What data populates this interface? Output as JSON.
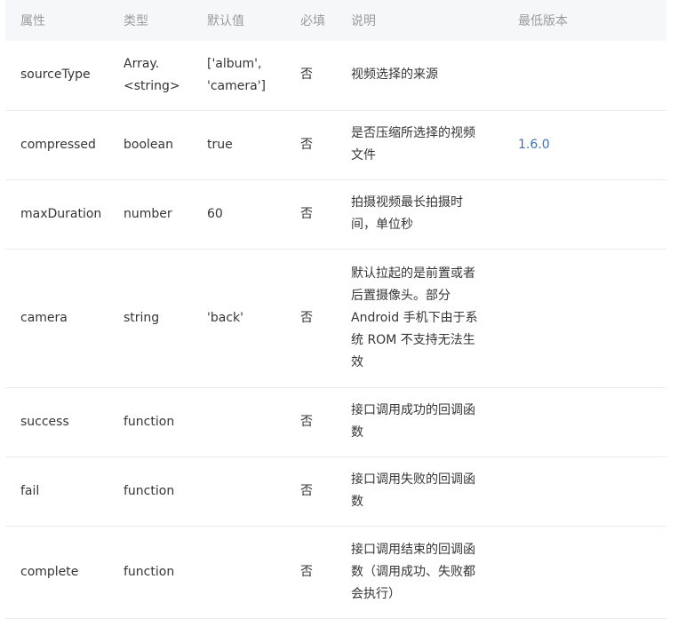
{
  "table": {
    "headers": [
      "属性",
      "类型",
      "默认值",
      "必填",
      "说明",
      "最低版本"
    ],
    "rows": [
      {
        "name": "sourceType",
        "type": "Array.<string>",
        "default": "['album', 'camera']",
        "required": "否",
        "description": "视频选择的来源",
        "version": ""
      },
      {
        "name": "compressed",
        "type": "boolean",
        "default": "true",
        "required": "否",
        "description": "是否压缩所选择的视频文件",
        "version": "1.6.0"
      },
      {
        "name": "maxDuration",
        "type": "number",
        "default": "60",
        "required": "否",
        "description": "拍摄视频最长拍摄时间，单位秒",
        "version": ""
      },
      {
        "name": "camera",
        "type": "string",
        "default": "'back'",
        "required": "否",
        "description": "默认拉起的是前置或者后置摄像头。部分 Android 手机下由于系统 ROM 不支持无法生效",
        "version": ""
      },
      {
        "name": "success",
        "type": "function",
        "default": "",
        "required": "否",
        "description": "接口调用成功的回调函数",
        "version": ""
      },
      {
        "name": "fail",
        "type": "function",
        "default": "",
        "required": "否",
        "description": "接口调用失败的回调函数",
        "version": ""
      },
      {
        "name": "complete",
        "type": "function",
        "default": "",
        "required": "否",
        "description": "接口调用结束的回调函数（调用成功、失败都会执行）",
        "version": ""
      }
    ]
  },
  "colors": {
    "header_bg": "#f6f7f9",
    "header_text": "#9b9b9b",
    "body_text": "#353535",
    "link": "#3b70b7",
    "row_border": "#e9ebee"
  }
}
